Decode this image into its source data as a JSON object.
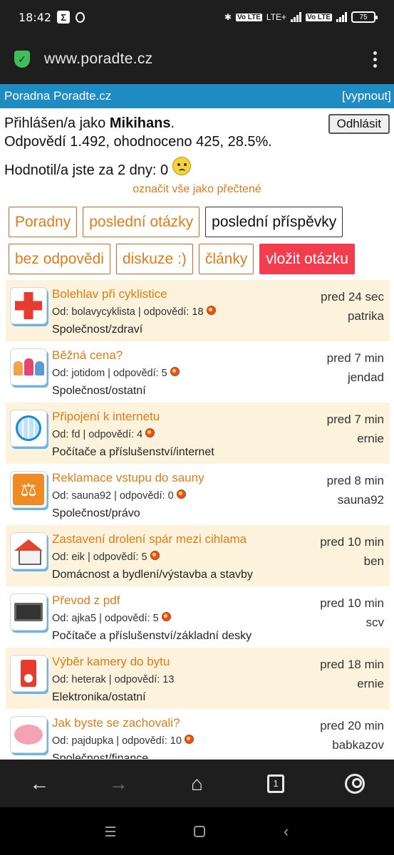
{
  "status": {
    "time": "18:42",
    "lte": "LTE+",
    "vo1": "Vo LTE",
    "vo2": "Vo LTE",
    "battery": "75"
  },
  "browser": {
    "url": "www.poradte.cz"
  },
  "site": {
    "title": "Poradna Poradte.cz",
    "turn_off": "[vypnout]"
  },
  "user": {
    "logged_prefix": "Přihlášen/a jako ",
    "username": "Mikihans",
    "logged_suffix": ".",
    "stats": "Odpovědí 1.492, ohodnoceno 425, 28.5%.",
    "logout": "Odhlásit",
    "rated": "Hodnotil/a jste za 2 dny: 0",
    "mark_read": "označit vše jako přečtené"
  },
  "nav": {
    "row1": [
      "Poradny",
      "poslední otázky",
      "poslední příspěvky"
    ],
    "row2": [
      "bez odpovědi",
      "diskuze :)",
      "články",
      "vložit otázku"
    ]
  },
  "questions": [
    {
      "icon": "health-icon",
      "title": "Bolehlav při cyklistice",
      "meta": "Od: bolavycyklista | odpovědí: 18",
      "dot": true,
      "category": "Společnost/zdraví",
      "time": "pred 24 sec",
      "user": "patrika"
    },
    {
      "icon": "people-icon",
      "title": "Běžná cena?",
      "meta": "Od: jotidom | odpovědí: 5",
      "dot": true,
      "category": "Společnost/ostatní",
      "time": "pred 7 min",
      "user": "jendad"
    },
    {
      "icon": "globe-icon",
      "title": "Připojení k internetu",
      "meta": "Od: fd | odpovědí: 4",
      "dot": true,
      "category": "Počítače a příslušenství/internet",
      "time": "pred 7 min",
      "user": "ernie"
    },
    {
      "icon": "scale-icon",
      "title": "Reklamace vstupu do sauny",
      "meta": "Od: sauna92 | odpovědí: 0",
      "dot": true,
      "category": "Společnost/právo",
      "time": "pred 8 min",
      "user": "sauna92"
    },
    {
      "icon": "house-icon",
      "title": "Zastavení drolení spár mezi cihlama",
      "meta": "Od: eik | odpovědí: 5",
      "dot": true,
      "category": "Domácnost a bydlení/výstavba a stavby",
      "time": "pred 10 min",
      "user": "ben"
    },
    {
      "icon": "computer-icon",
      "title": "Převod z pdf",
      "meta": "Od: ajka5 | odpovědí: 5",
      "dot": true,
      "category": "Počítače a příslušenství/základní desky",
      "time": "pred 10 min",
      "user": "scv"
    },
    {
      "icon": "camera-icon",
      "title": "Výběr kamery do bytu",
      "meta": "Od: heterak | odpovědí: 13",
      "dot": false,
      "category": "Elektronika/ostatní",
      "time": "pred 18 min",
      "user": "ernie"
    },
    {
      "icon": "piggy-bank-icon",
      "title": "Jak byste se zachovali?",
      "meta": "Od: pajdupka | odpovědí: 10",
      "dot": true,
      "category": "Společnost/finance",
      "time": "pred 20 min",
      "user": "babkazov"
    }
  ],
  "bottom": {
    "tabs_count": "1"
  }
}
